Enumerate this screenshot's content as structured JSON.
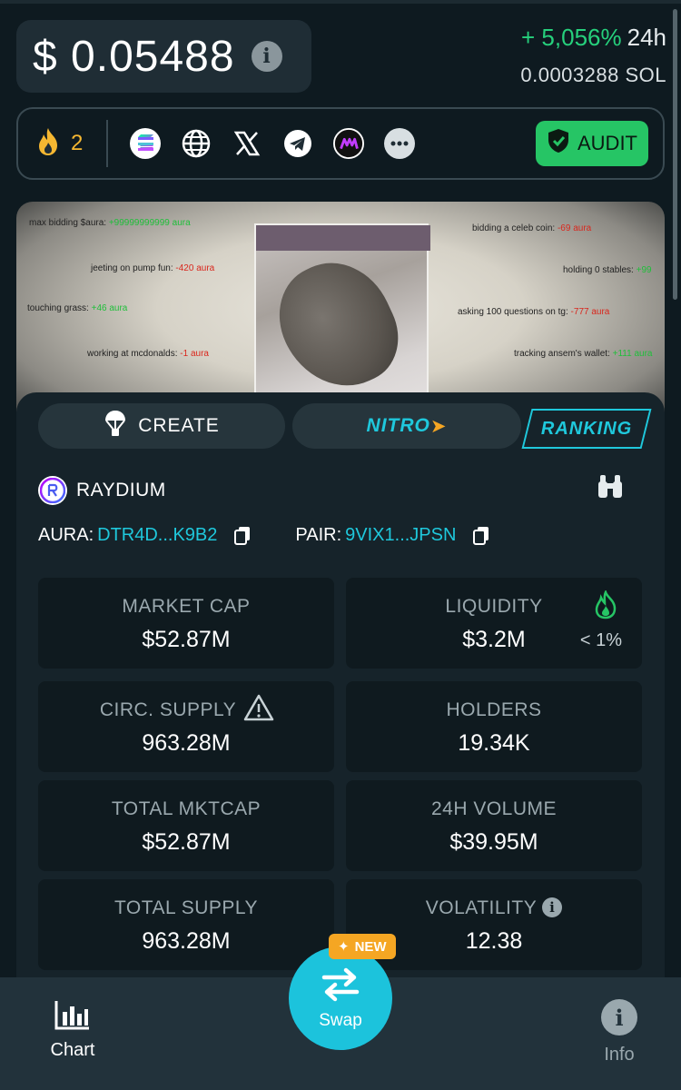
{
  "header": {
    "price": "$ 0.05488",
    "change_pct": "+ 5,056%",
    "change_period": "24h",
    "sol_price": "0.0003288  SOL"
  },
  "social": {
    "fire_count": "2",
    "icons": [
      "solana-icon",
      "globe-icon",
      "x-icon",
      "telegram-icon",
      "dexscreener-icon",
      "more-icon"
    ],
    "audit_label": "AUDIT"
  },
  "banner": {
    "texts": [
      {
        "label": "max bidding $aura:",
        "value": "+99999999999 aura",
        "color": "green"
      },
      {
        "label": "jeeting on pump fun:",
        "value": "-420 aura",
        "color": "red"
      },
      {
        "label": "touching grass:",
        "value": "+46 aura",
        "color": "green"
      },
      {
        "label": "working at mcdonalds:",
        "value": "-1 aura",
        "color": "red"
      },
      {
        "label": "bidding a celeb coin:",
        "value": "-69 aura",
        "color": "red"
      },
      {
        "label": "holding 0 stables:",
        "value": "+99",
        "color": "green"
      },
      {
        "label": "asking 100 questions on tg:",
        "value": "-777 aura",
        "color": "red"
      },
      {
        "label": "tracking ansem's wallet:",
        "value": "+111 aura",
        "color": "green"
      }
    ]
  },
  "tabs": {
    "create": "CREATE",
    "nitro": "NITRO",
    "ranking": "RANKING"
  },
  "dex": {
    "name": "RAYDIUM",
    "aura_label": "AURA:",
    "aura_addr": "DTR4D...K9B2",
    "pair_label": "PAIR:",
    "pair_addr": "9VIX1...JPSN"
  },
  "stats": {
    "market_cap": {
      "label": "MARKET CAP",
      "value": "$52.87M"
    },
    "liquidity": {
      "label": "LIQUIDITY",
      "value": "$3.2M",
      "pct": "< 1%"
    },
    "circ_supply": {
      "label": "CIRC. SUPPLY",
      "value": "963.28M"
    },
    "holders": {
      "label": "HOLDERS",
      "value": "19.34K"
    },
    "total_mktcap": {
      "label": "TOTAL MKTCAP",
      "value": "$52.87M"
    },
    "volume_24h": {
      "label": "24H VOLUME",
      "value": "$39.95M"
    },
    "total_supply": {
      "label": "TOTAL SUPPLY",
      "value": "963.28M"
    },
    "volatility": {
      "label": "VOLATILITY",
      "value": "12.38"
    }
  },
  "nav": {
    "chart": "Chart",
    "swap": "Swap",
    "new_badge": "NEW",
    "info": "Info"
  },
  "colors": {
    "accent": "#1fc8dc",
    "positive": "#26d07c",
    "audit": "#26c565",
    "badge": "#f5a623"
  }
}
